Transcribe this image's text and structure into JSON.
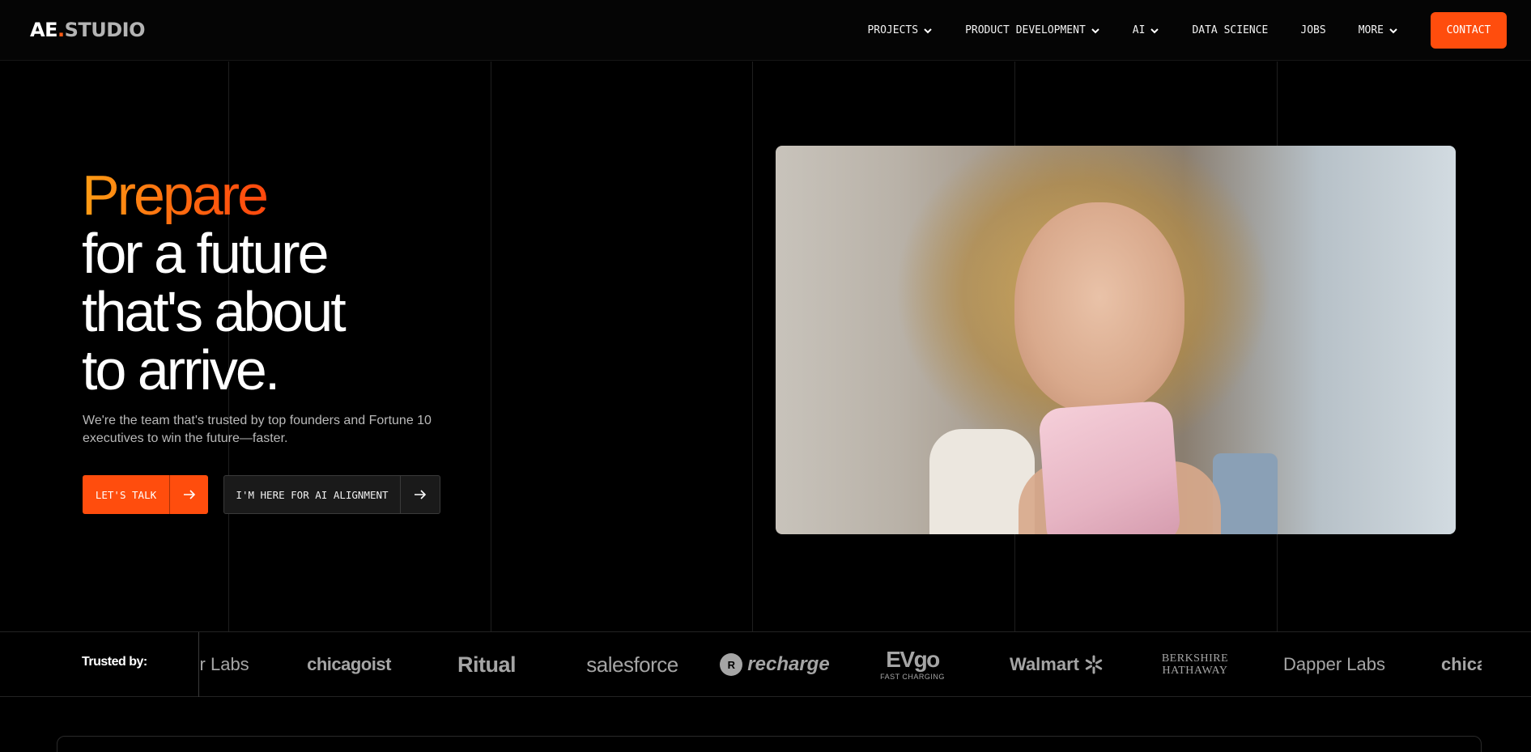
{
  "header": {
    "logo": {
      "part1": "AE",
      "dot": ".",
      "part2": "STUDIO"
    },
    "nav": [
      {
        "label": "PROJECTS",
        "has_dropdown": true
      },
      {
        "label": "PRODUCT DEVELOPMENT",
        "has_dropdown": true
      },
      {
        "label": "AI",
        "has_dropdown": true
      },
      {
        "label": "DATA SCIENCE",
        "has_dropdown": false
      },
      {
        "label": "JOBS",
        "has_dropdown": false
      },
      {
        "label": "MORE",
        "has_dropdown": true
      }
    ],
    "contact_label": "CONTACT"
  },
  "hero": {
    "headline_accent": "Prepare",
    "headline_lines": [
      "for a future",
      "that's about",
      "to arrive."
    ],
    "subtext": "We're the team that's trusted by top founders and Fortune 10 executives to win the future—faster.",
    "primary_button": {
      "label": "LET'S TALK",
      "icon": "arrow-right-icon"
    },
    "secondary_button": {
      "label": "I'M HERE FOR AI ALIGNMENT",
      "icon": "arrow-right-icon"
    }
  },
  "trusted": {
    "label": "Trusted by:",
    "logos": [
      {
        "name": "dapper-labs-partial",
        "text": "er Labs"
      },
      {
        "name": "chicagoist",
        "text": "chicagoist"
      },
      {
        "name": "ritual",
        "text": "Ritual"
      },
      {
        "name": "salesforce",
        "text": "salesforce"
      },
      {
        "name": "recharge",
        "text": "recharge",
        "badge": "R"
      },
      {
        "name": "evgo",
        "text": "EVgo",
        "subtext": "FAST CHARGING"
      },
      {
        "name": "walmart",
        "text": "Walmart"
      },
      {
        "name": "berkshire-hathaway",
        "line1": "BERKSHIRE",
        "line2": "HATHAWAY"
      },
      {
        "name": "dapper-labs",
        "text": "Dapper Labs"
      },
      {
        "name": "chicagoist-partial",
        "text": "chica"
      }
    ]
  },
  "colors": {
    "accent": "#ff4d0d",
    "gradient_start": "#ff9d14",
    "gradient_end": "#ff2d0c",
    "background": "#000000",
    "logo_gray": "#a5a5a5"
  }
}
